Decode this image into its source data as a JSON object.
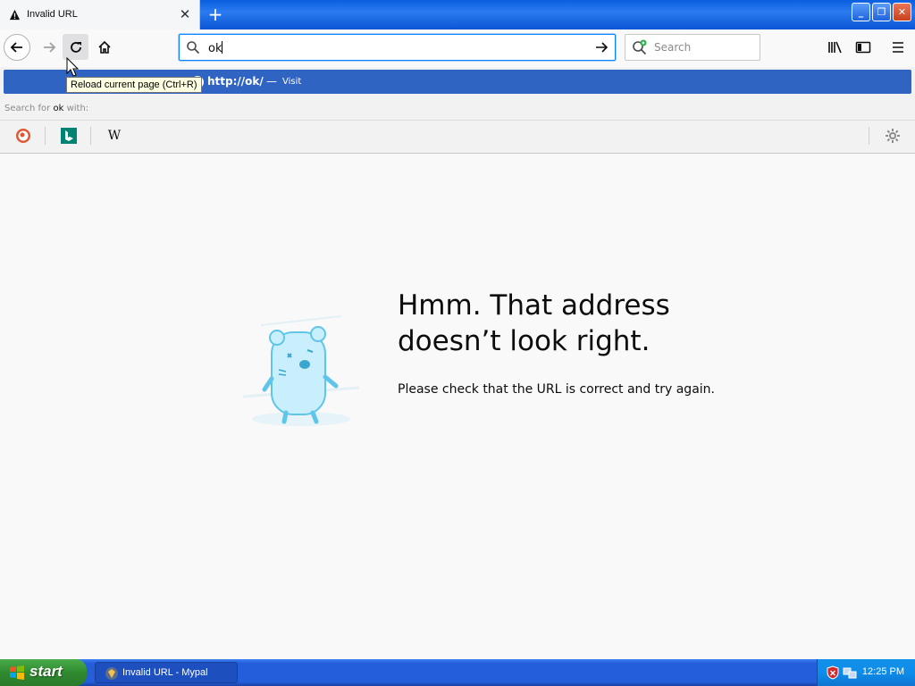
{
  "tab": {
    "title": "Invalid URL",
    "close_glyph": "✕",
    "icon": "warning-icon"
  },
  "new_tab_glyph": "+",
  "window_controls": {
    "minimize": "_",
    "restore": "❐",
    "close": "✕"
  },
  "urlbar": {
    "value": "ok"
  },
  "search": {
    "placeholder": "Search"
  },
  "autocomplete": {
    "url": "http://ok/",
    "dash": "—",
    "action": "Visit",
    "search_with_prefix": "Search for ",
    "search_with_term": "ok",
    "search_with_suffix": " with:",
    "engines": [
      "duckduckgo-icon",
      "bing-icon",
      "wikipedia-icon"
    ],
    "wikipedia_glyph": "W"
  },
  "tooltip": "Reload current page (Ctrl+R)",
  "error": {
    "headline": "Hmm. That address doesn’t look right.",
    "description": "Please check that the URL is correct and try again."
  },
  "taskbar": {
    "start_label": "start",
    "task_label": "Invalid URL - Mypal",
    "clock": "12:25 PM"
  },
  "colors": {
    "accent": "#0a84ff",
    "selected_row": "#2f64c3",
    "taskbar": "#245edb",
    "start_green": "#2f8a2f"
  }
}
